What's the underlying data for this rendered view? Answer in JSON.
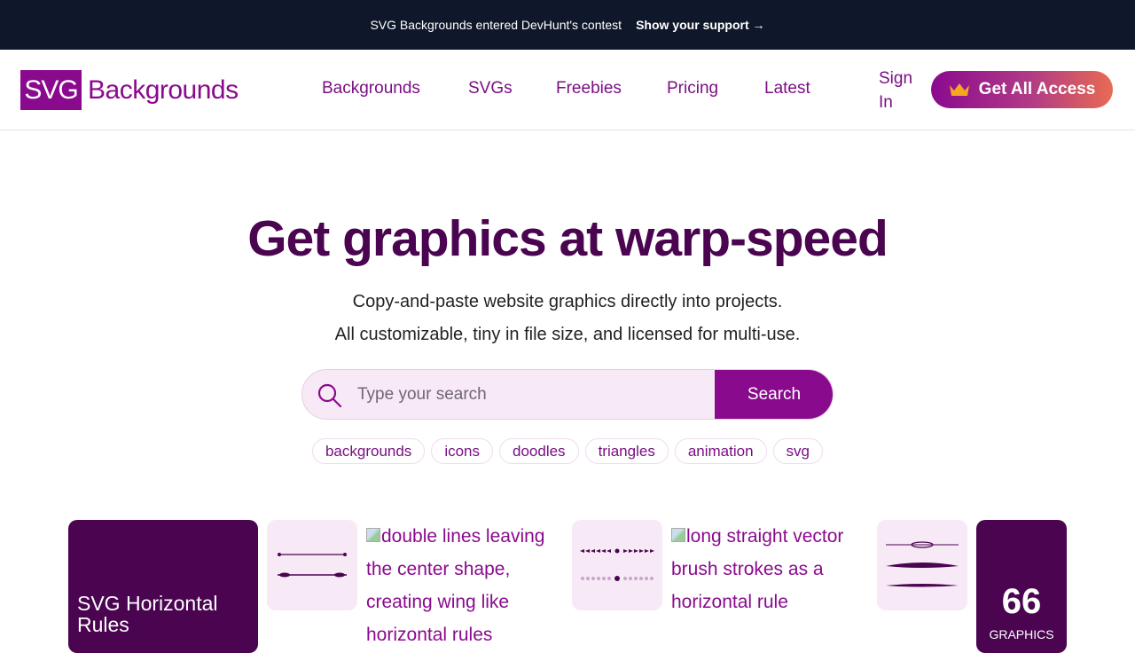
{
  "banner": {
    "text": "SVG Backgrounds entered DevHunt's contest",
    "link": "Show your support →"
  },
  "logo": {
    "box": "SVG",
    "word": "Backgrounds"
  },
  "nav": {
    "items": [
      "Backgrounds",
      "SVGs",
      "Freebies",
      "Pricing",
      "Latest"
    ],
    "signin": "Sign In",
    "cta": "Get All Access"
  },
  "hero": {
    "title": "Get graphics at warp-speed",
    "line1": "Copy-and-paste website graphics directly into projects.",
    "line2": "All customizable, tiny in file size, and licensed for multi-use."
  },
  "search": {
    "placeholder": "Type your search",
    "button": "Search"
  },
  "tags": [
    "backgrounds",
    "icons",
    "doodles",
    "triangles",
    "animation",
    "svg"
  ],
  "cards": {
    "category_title": "SVG Horizontal Rules",
    "alt1": "double lines leaving the center shape, creating wing like horizontal rules",
    "alt2": "long straight vector brush strokes as a horizontal rule",
    "count": "66",
    "count_label": "GRAPHICS"
  },
  "colors": {
    "brand": "#8a0a8e",
    "dark": "#4a0450",
    "banner": "#0f172a"
  }
}
